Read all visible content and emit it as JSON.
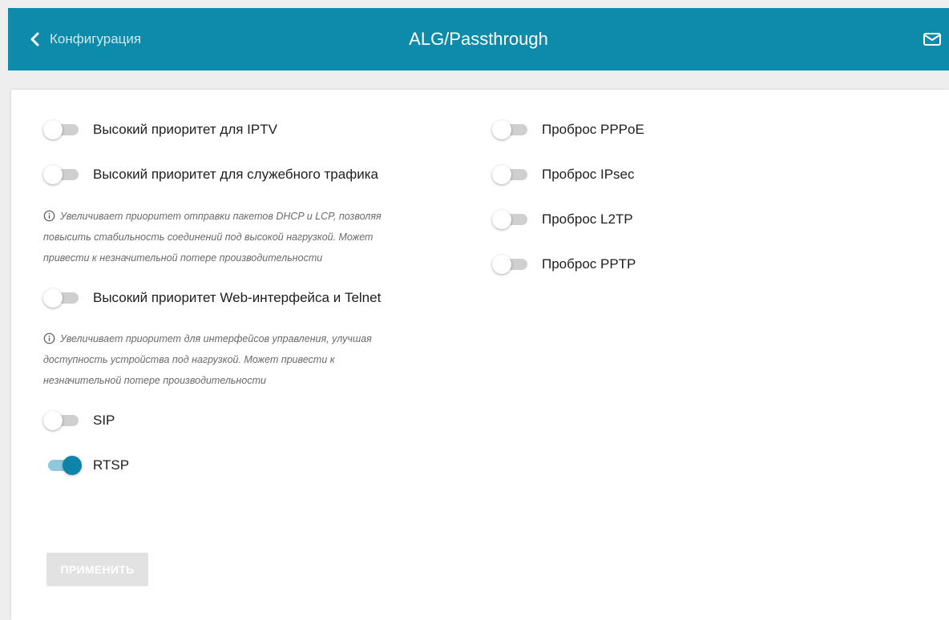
{
  "header": {
    "back_label": "Конфигурация",
    "title": "ALG/Passthrough",
    "back_icon": "chevron-left-icon",
    "mail_icon": "envelope-icon",
    "color": "#0e8aab"
  },
  "left": {
    "iptv": {
      "label": "Высокий приоритет для IPTV",
      "on": false
    },
    "service": {
      "label": "Высокий приоритет для служебного трафика",
      "on": false
    },
    "service_hint": [
      "Увеличивает приоритет отправки пакетов DHCP и LCP, позволяя",
      "повысить стабильность соединений под высокой нагрузкой. Может",
      "привести к незначительной потере производительности"
    ],
    "web": {
      "label": "Высокий приоритет Web-интерфейса и Telnet",
      "on": false
    },
    "web_hint": [
      "Увеличивает приоритет для интерфейсов управления, улучшая",
      "доступность устройства под нагрузкой. Может привести к",
      "незначительной потере производительности"
    ],
    "sip": {
      "label": "SIP",
      "on": false
    },
    "rtsp": {
      "label": "RTSP",
      "on": true
    }
  },
  "right": {
    "pppoe": {
      "label": "Проброс PPPoE",
      "on": false
    },
    "ipsec": {
      "label": "Проброс IPsec",
      "on": false
    },
    "l2tp": {
      "label": "Проброс L2TP",
      "on": false
    },
    "pptp": {
      "label": "Проброс PPTP",
      "on": false
    }
  },
  "apply_label": "ПРИМЕНИТЬ",
  "accent_color": "#0f84aa"
}
